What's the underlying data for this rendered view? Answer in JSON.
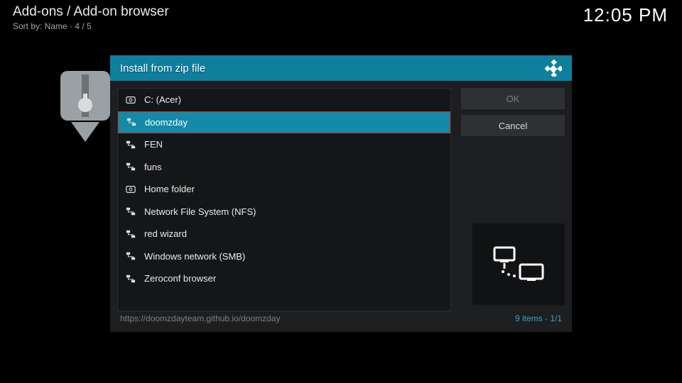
{
  "header": {
    "breadcrumb": "Add-ons / Add-on browser",
    "sort_label": "Sort by: Name",
    "sort_index": "4 / 5",
    "clock": "12:05 PM"
  },
  "dialog": {
    "title": "Install from zip file",
    "ok_label": "OK",
    "cancel_label": "Cancel",
    "footer_path": "https://doomzdayteam.github.io/doomzday",
    "footer_count": "9 items",
    "footer_page": "1/1",
    "selected_index": 1,
    "items": [
      {
        "label": "C: (Acer)",
        "icon": "drive"
      },
      {
        "label": "doomzday",
        "icon": "net"
      },
      {
        "label": "FEN",
        "icon": "net"
      },
      {
        "label": "funs",
        "icon": "net"
      },
      {
        "label": "Home folder",
        "icon": "drive"
      },
      {
        "label": "Network File System (NFS)",
        "icon": "net"
      },
      {
        "label": "red wizard",
        "icon": "net"
      },
      {
        "label": "Windows network (SMB)",
        "icon": "net"
      },
      {
        "label": "Zeroconf browser",
        "icon": "net"
      }
    ]
  }
}
